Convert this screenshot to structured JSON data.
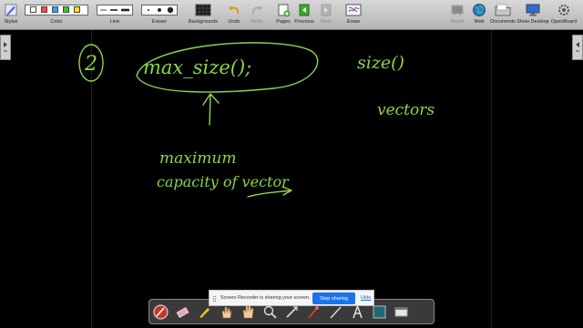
{
  "toolbar": {
    "stylus": "Stylus",
    "color": "Color",
    "line": "Line",
    "eraser": "Eraser",
    "backgrounds": "Backgrounds",
    "undo": "Undo",
    "redo": "Redo",
    "pages": "Pages",
    "previous": "Previous",
    "next": "Next",
    "erase": "Erase",
    "board": "Board",
    "web": "Web",
    "documents": "Documents",
    "show_desktop": "Show Desktop",
    "openboard": "OpenBoard"
  },
  "colors": [
    "#ffffff",
    "#ff4a4a",
    "#3aa0ff",
    "#37c837",
    "#ffe400"
  ],
  "ink_color": "#8bd64a",
  "board_text": {
    "number": "2",
    "code": "max_size();",
    "right_top": "size()",
    "right_mid": "vectors",
    "note_line1": "maximum",
    "note_line2": "capacity of vector"
  },
  "share_bar": {
    "message": "Screen Recorder is sharing your screen.",
    "stop_label": "Stop sharing",
    "hide_label": "Hide"
  }
}
